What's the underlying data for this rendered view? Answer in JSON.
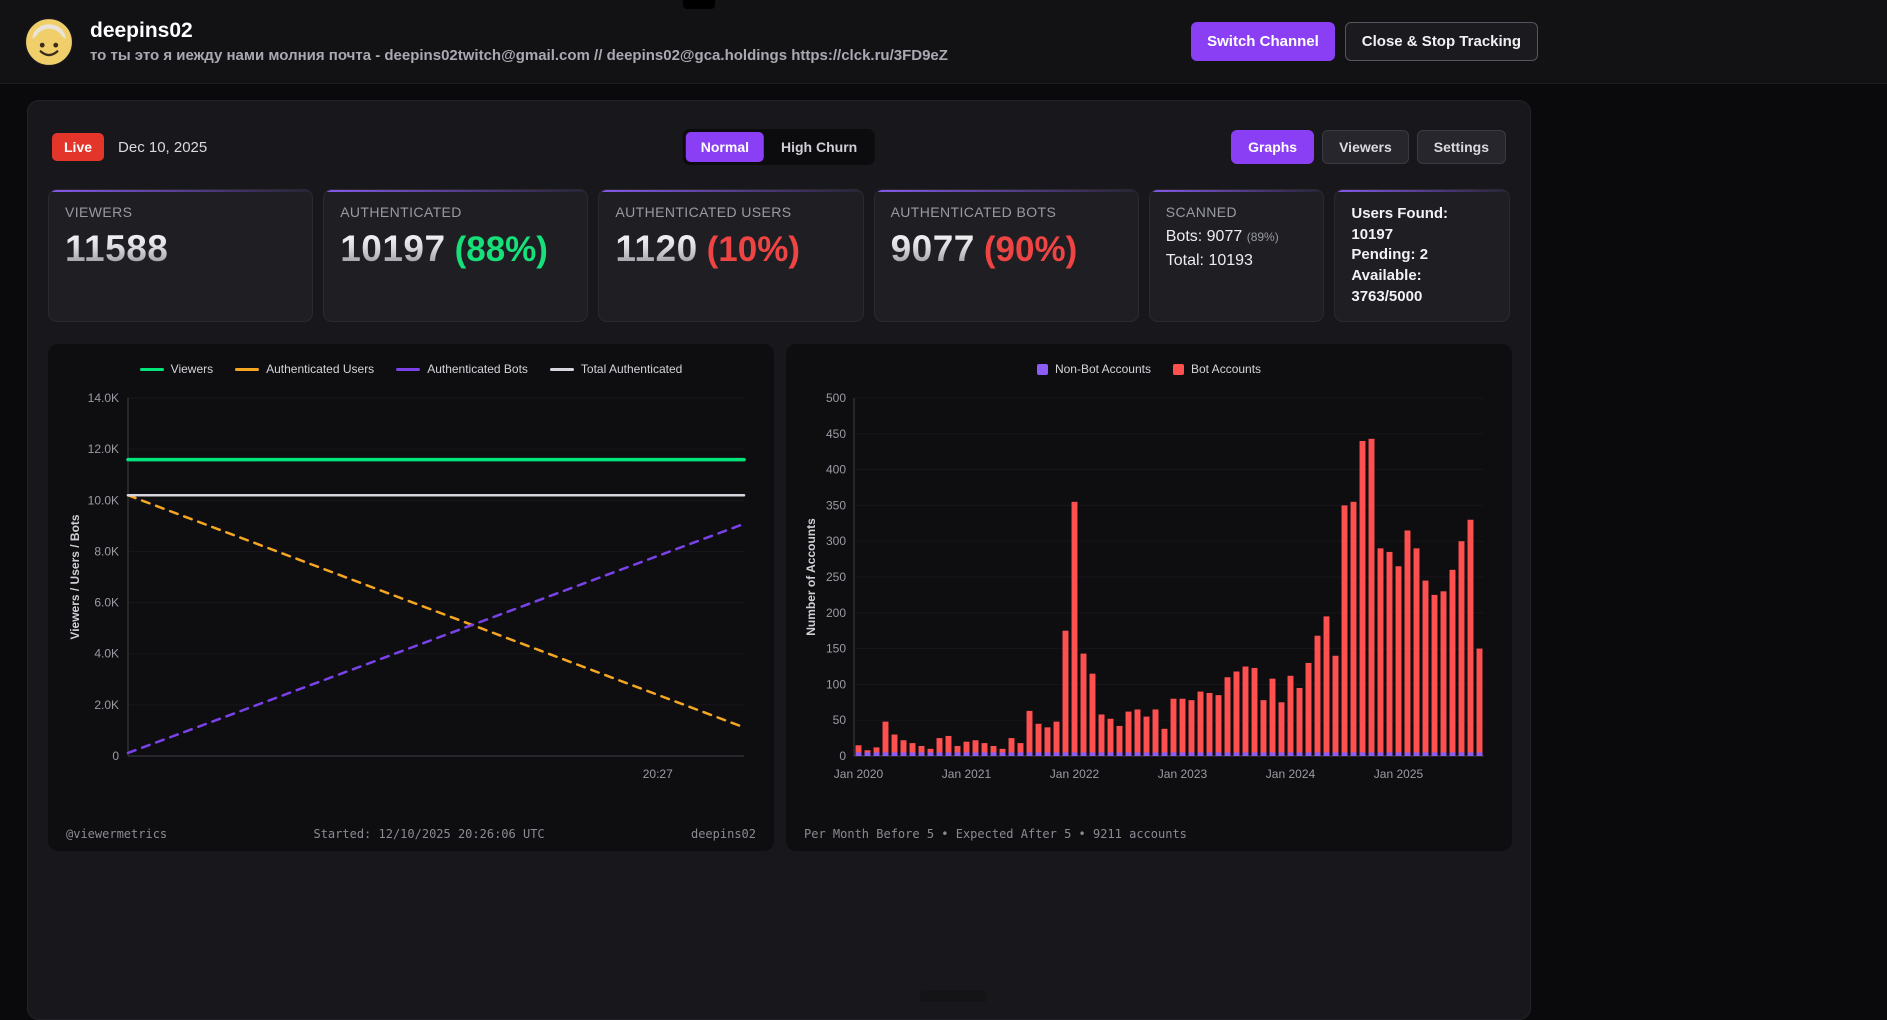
{
  "colors": {
    "accent": "#8a3ff5",
    "live": "#e4352b",
    "green": "#16e07a",
    "red": "#ef4444"
  },
  "header": {
    "title": "deepins02",
    "subtitle": "то ты это я иежду нами молния почта - deepins02twitch@gmail.com // deepins02@gca.holdings https://clck.ru/3FD9eZ",
    "switch_channel": "Switch Channel",
    "close_stop": "Close & Stop Tracking"
  },
  "toolbar": {
    "live": "Live",
    "date": "Dec 10, 2025",
    "mode_normal": "Normal",
    "mode_high_churn": "High Churn",
    "graphs": "Graphs",
    "viewers": "Viewers",
    "settings": "Settings"
  },
  "stats": {
    "viewers": {
      "label": "VIEWERS",
      "value": "11588"
    },
    "authenticated": {
      "label": "AUTHENTICATED",
      "value": "10197",
      "pct": "(88%)"
    },
    "auth_users": {
      "label": "AUTHENTICATED USERS",
      "value": "1120",
      "pct": "(10%)"
    },
    "auth_bots": {
      "label": "AUTHENTICATED BOTS",
      "value": "9077",
      "pct": "(90%)"
    },
    "scanned": {
      "label": "SCANNED",
      "bots_text": "Bots: 9077",
      "bots_pct": "(89%)",
      "total_text": "Total: 10193"
    },
    "found": {
      "line1": "Users Found: 10197",
      "line2": "Pending: 2",
      "line3": "Available:",
      "line4": "3763/5000"
    }
  },
  "line_footer": {
    "left": "@viewermetrics",
    "center": "Started: 12/10/2025 20:26:06 UTC",
    "right": "deepins02"
  },
  "bar_footer": "Per Month Before 5 • Expected After 5 • 9211 accounts",
  "chart_data": [
    {
      "type": "line",
      "title": "Viewers / authentication over time",
      "ylabel": "Viewers / Users / Bots",
      "ylim": [
        0,
        14000
      ],
      "yticks": [
        0,
        2000,
        4000,
        6000,
        8000,
        10000,
        12000,
        14000
      ],
      "ytick_labels": [
        "0",
        "2.0K",
        "4.0K",
        "6.0K",
        "8.0K",
        "10.0K",
        "12.0K",
        "14.0K"
      ],
      "xtick": {
        "label": "20:27",
        "pos": 0.86
      },
      "grid": false,
      "legend_position": "top",
      "series": [
        {
          "name": "Viewers",
          "color": "#00e67a",
          "style": "solid",
          "width": 3.5,
          "points": [
            [
              0,
              11588
            ],
            [
              1,
              11588
            ]
          ]
        },
        {
          "name": "Authenticated Users",
          "color": "#f5a623",
          "style": "dashed",
          "width": 2.5,
          "points": [
            [
              0,
              10197
            ],
            [
              1,
              1120
            ]
          ]
        },
        {
          "name": "Authenticated Bots",
          "color": "#7a42e8",
          "style": "dashed",
          "width": 2.5,
          "points": [
            [
              0,
              120
            ],
            [
              1,
              9077
            ]
          ]
        },
        {
          "name": "Total Authenticated",
          "color": "#d6d6de",
          "style": "solid",
          "width": 2.5,
          "points": [
            [
              0,
              10197
            ],
            [
              1,
              10197
            ]
          ]
        }
      ]
    },
    {
      "type": "bar",
      "title": "Accounts created per month",
      "ylabel": "Number of Accounts",
      "ylim": [
        0,
        500
      ],
      "yticks": [
        0,
        50,
        100,
        150,
        200,
        250,
        300,
        350,
        400,
        450,
        500
      ],
      "x_start": "Jan 2020",
      "tick_every": 12,
      "xtick_labels": [
        "Jan 2020",
        "Jan 2021",
        "Jan 2022",
        "Jan 2023",
        "Jan 2024",
        "Jan 2025"
      ],
      "legend_position": "top",
      "series": [
        {
          "name": "Non-Bot Accounts",
          "color": "#8b5cf6",
          "values": [
            5,
            5,
            5,
            5,
            5,
            5,
            5,
            5,
            5,
            5,
            5,
            5,
            5,
            5,
            5,
            5,
            5,
            5,
            5,
            5,
            5,
            5,
            5,
            5,
            5,
            5,
            5,
            5,
            5,
            5,
            5,
            5,
            5,
            5,
            5,
            5,
            5,
            5,
            5,
            5,
            5,
            5,
            5,
            5,
            5,
            5,
            5,
            5,
            5,
            5,
            5,
            5,
            5,
            5,
            5,
            5,
            5,
            5,
            5,
            5,
            5,
            5,
            5,
            5,
            5,
            5,
            5,
            5,
            5,
            5
          ]
        },
        {
          "name": "Bot Accounts",
          "color": "#ff5050",
          "values": [
            15,
            8,
            12,
            48,
            30,
            22,
            18,
            14,
            10,
            25,
            28,
            14,
            20,
            22,
            18,
            14,
            10,
            25,
            18,
            63,
            45,
            40,
            48,
            175,
            355,
            143,
            115,
            58,
            52,
            42,
            62,
            65,
            55,
            65,
            38,
            80,
            80,
            78,
            90,
            88,
            85,
            110,
            118,
            125,
            123,
            78,
            108,
            75,
            112,
            95,
            130,
            168,
            195,
            140,
            350,
            355,
            440,
            443,
            290,
            285,
            265,
            315,
            290,
            245,
            225,
            230,
            260,
            300,
            330,
            150
          ]
        }
      ]
    }
  ]
}
